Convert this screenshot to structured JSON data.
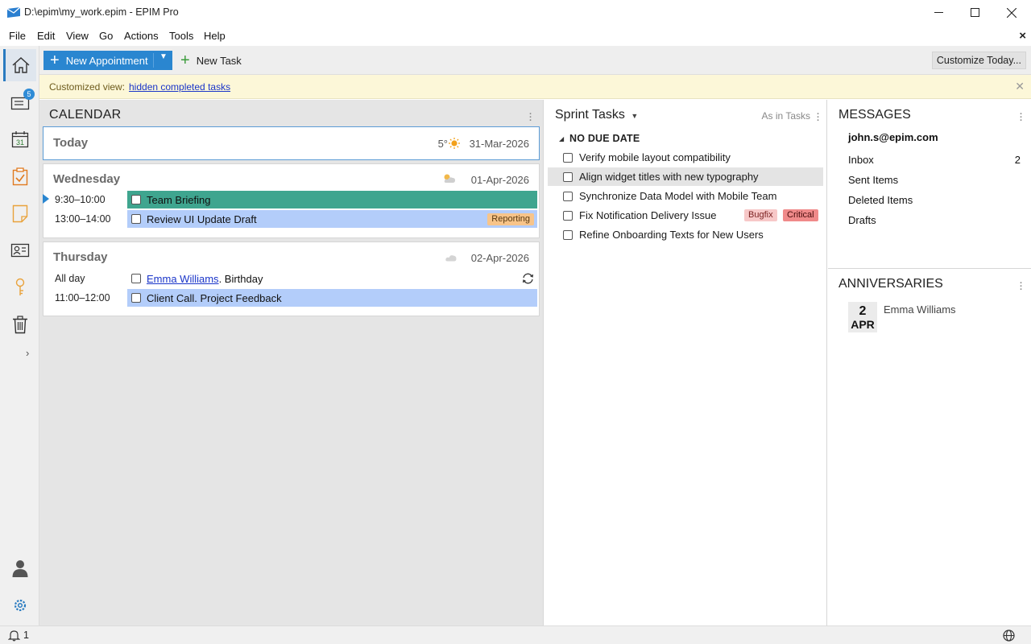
{
  "window": {
    "title": "D:\\epim\\my_work.epim - EPIM Pro"
  },
  "menu": {
    "items": [
      "File",
      "Edit",
      "View",
      "Go",
      "Actions",
      "Tools",
      "Help"
    ]
  },
  "rail": {
    "items": [
      "home-icon",
      "mail-icon",
      "calendar-icon",
      "tasks-icon",
      "notes-icon",
      "contacts-icon",
      "passwords-icon",
      "trash-icon"
    ],
    "mail_badge": "5",
    "calendar_day": "31"
  },
  "toolbar": {
    "new_appointment": "New Appointment",
    "new_task": "New Task",
    "customize": "Customize Today..."
  },
  "infobar": {
    "label": "Customized view:",
    "link": "hidden completed tasks"
  },
  "calendar": {
    "title": "CALENDAR",
    "today": {
      "title": "Today",
      "temp": "5°",
      "date": "31-Mar-2026"
    },
    "wednesday": {
      "title": "Wednesday",
      "date": "01-Apr-2026",
      "events": [
        {
          "time": "9:30–10:00",
          "title": "Team Briefing",
          "color": "#3fa58f"
        },
        {
          "time": "13:00–14:00",
          "title": "Review UI Update Draft",
          "color": "#b3cdfa",
          "tag": "Reporting"
        }
      ]
    },
    "thursday": {
      "title": "Thursday",
      "date": "02-Apr-2026",
      "events": [
        {
          "time": "All day",
          "link": "Emma Williams",
          "suffix": ". Birthday"
        },
        {
          "time": "11:00–12:00",
          "title": "Client Call. Project Feedback",
          "color": "#b3cdfa"
        }
      ]
    }
  },
  "tasks": {
    "title": "Sprint Tasks",
    "mode": "As in Tasks",
    "group": "NO DUE DATE",
    "items": [
      "Verify mobile layout compatibility",
      "Align widget titles with new typography",
      "Synchronize Data Model with Mobile Team",
      "Fix Notification Delivery Issue",
      "Refine Onboarding Texts for New Users"
    ],
    "tags": {
      "bugfix": "Bugfix",
      "critical": "Critical"
    }
  },
  "messages": {
    "title": "MESSAGES",
    "account": "john.s@epim.com",
    "folders": [
      "Inbox",
      "Sent Items",
      "Deleted Items",
      "Drafts"
    ],
    "inbox_count": "2"
  },
  "anniversaries": {
    "title": "ANNIVERSARIES",
    "day": "2",
    "month": "APR",
    "name": "Emma Williams"
  },
  "status": {
    "notifications": "1"
  }
}
